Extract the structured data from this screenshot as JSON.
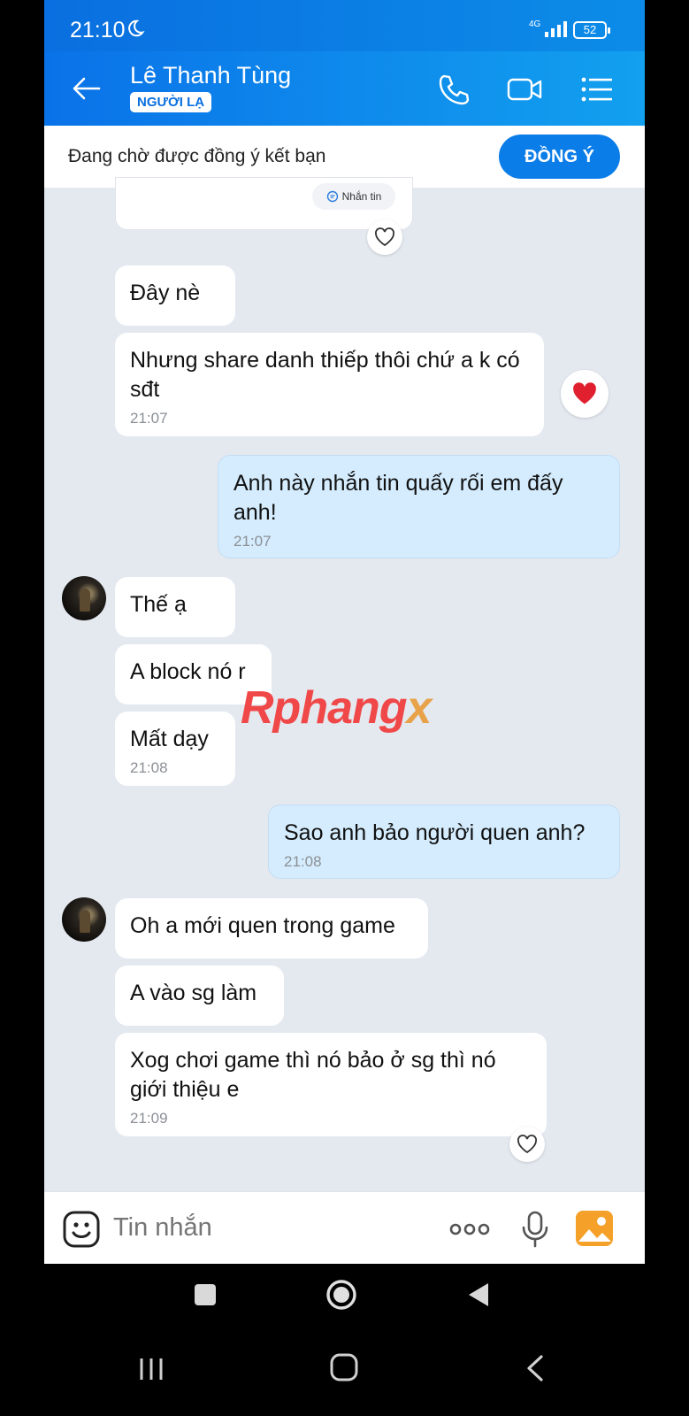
{
  "status_bar": {
    "time": "21:10",
    "network": "4G",
    "battery": "52"
  },
  "header": {
    "contact_name": "Lê Thanh Tùng",
    "stranger_tag": "NGƯỜI LẠ"
  },
  "friend_request": {
    "status_text": "Đang chờ được đồng ý kết bạn",
    "accept_label": "ĐỒNG Ý"
  },
  "shared_card": {
    "message_button": "Nhắn tin"
  },
  "messages": [
    {
      "text": "Đây nè",
      "time": ""
    },
    {
      "text": "Nhưng share danh thiếp thôi chứ a k có sđt",
      "time": "21:07"
    },
    {
      "text": " Anh này nhắn tin quấy rối em đấy anh!",
      "time": "21:07"
    },
    {
      "text": "Thế ạ",
      "time": ""
    },
    {
      "text": "A block nó r",
      "time": ""
    },
    {
      "text": "Mất dạy",
      "time": "21:08"
    },
    {
      "text": "Sao anh bảo người quen anh?",
      "time": "21:08"
    },
    {
      "text": "Oh a mới quen trong game",
      "time": ""
    },
    {
      "text": "A vào sg làm",
      "time": ""
    },
    {
      "text": "Xog chơi game thì nó bảo ở sg thì nó giới thiệu e",
      "time": "21:09"
    }
  ],
  "watermark": {
    "part1": "Rphang",
    "part2": "x"
  },
  "composer": {
    "placeholder": "Tin nhắn"
  },
  "colors": {
    "primary": "#0a7de8",
    "my_bubble": "#d4ecfd",
    "chat_bg": "#e4e9f0",
    "heart": "#e0202e"
  },
  "icons": [
    "back-arrow-icon",
    "phone-icon",
    "video-call-icon",
    "menu-icon",
    "heart-icon",
    "emoji-icon",
    "more-icon",
    "microphone-icon",
    "gallery-icon",
    "stop-icon",
    "home-icon",
    "back-icon",
    "recent-apps-icon"
  ]
}
